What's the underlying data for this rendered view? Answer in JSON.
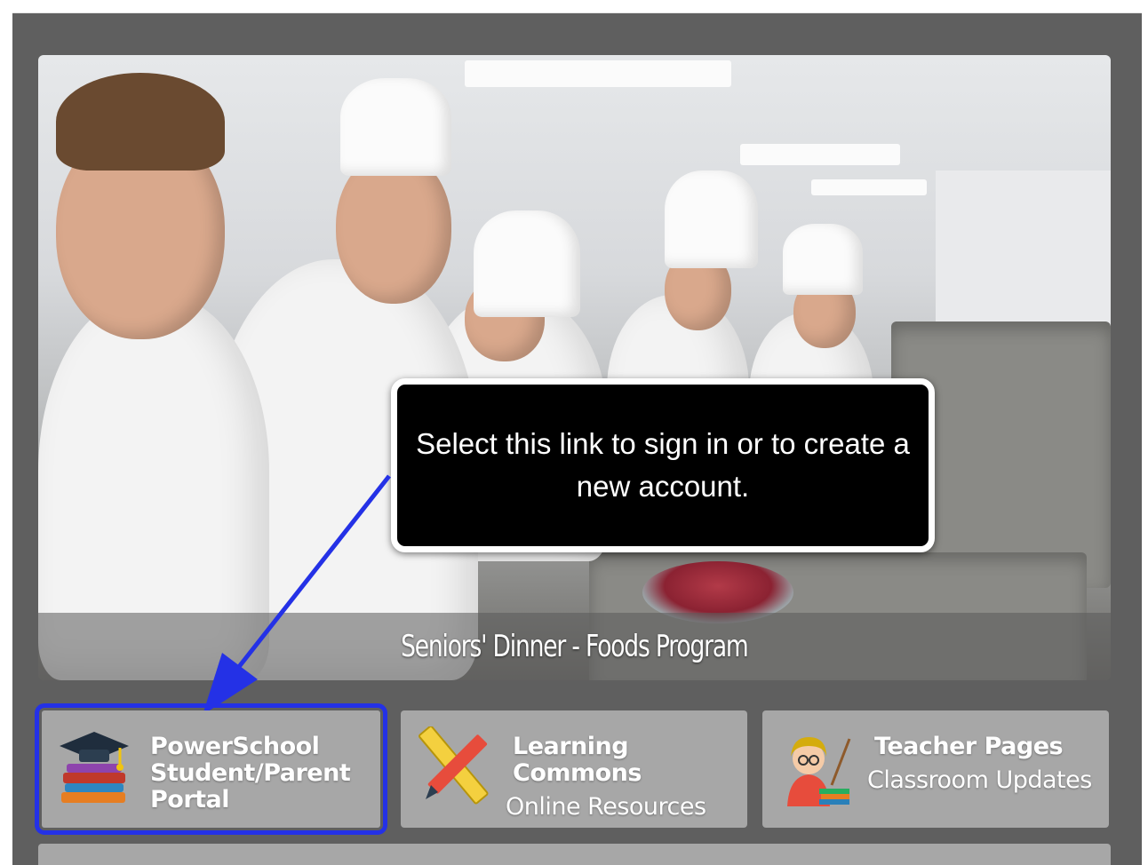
{
  "slideshow": {
    "caption": "Seniors' Dinner - Foods Program"
  },
  "callout": {
    "text": "Select this link to sign in or to create a new account."
  },
  "tiles": [
    {
      "title": "PowerSchool Student/Parent Portal",
      "subtitle": "",
      "icon": "graduation-cap-books-icon",
      "highlighted": true
    },
    {
      "title": "Learning Commons",
      "subtitle": "Online Resources",
      "icon": "pencil-ruler-icon"
    },
    {
      "title": "Teacher Pages",
      "subtitle": "Classroom Updates",
      "icon": "teacher-icon"
    }
  ],
  "colors": {
    "frame": "#5f5f5f",
    "tile": "#a7a7a7",
    "highlight": "#2431e6",
    "callout_bg": "#000000"
  }
}
